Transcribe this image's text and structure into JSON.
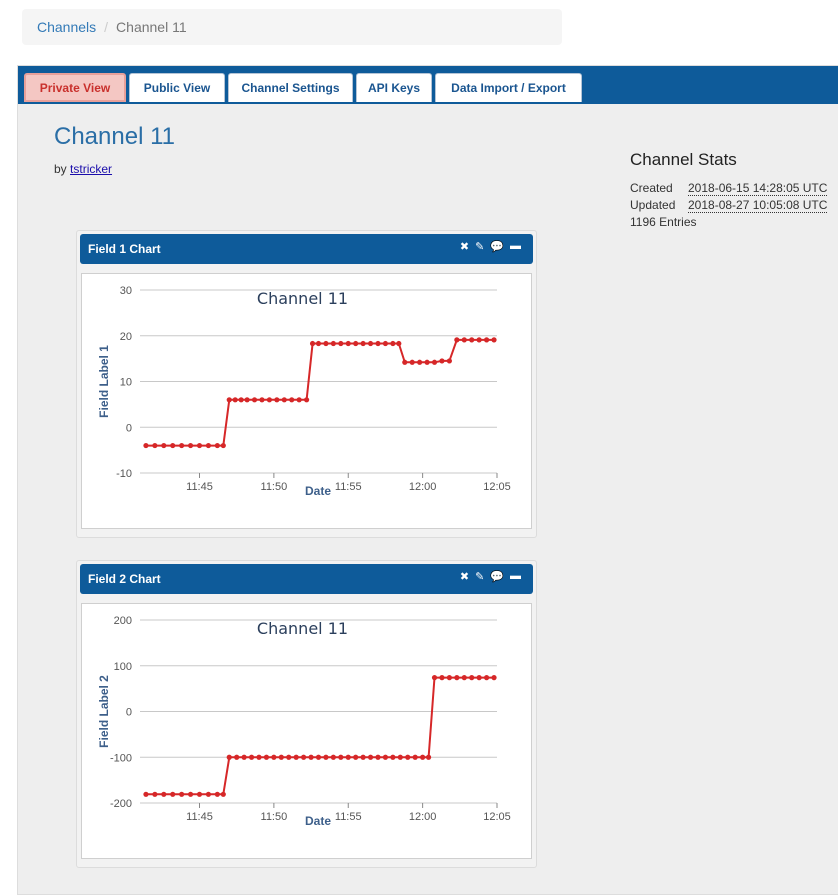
{
  "breadcrumb": {
    "root": "Channels",
    "separator": "/",
    "current": "Channel 11"
  },
  "tabs": [
    {
      "label": "Private View",
      "active": true
    },
    {
      "label": "Public View",
      "active": false
    },
    {
      "label": "Channel Settings",
      "active": false
    },
    {
      "label": "API Keys",
      "active": false
    },
    {
      "label": "Data Import / Export",
      "active": false
    }
  ],
  "channel": {
    "title": "Channel 11",
    "by_prefix": "by",
    "author": "tstricker"
  },
  "stats": {
    "heading": "Channel Stats",
    "created_label": "Created",
    "created_value": "2018-06-15 14:28:05 UTC",
    "updated_label": "Updated",
    "updated_value": "2018-08-27 10:05:08 UTC",
    "entries": "1196 Entries"
  },
  "panels": [
    {
      "title": "Field 1 Chart",
      "tools": {
        "close": "✖",
        "edit": "✎",
        "comment": "💬",
        "minimize": "▬"
      }
    },
    {
      "title": "Field 2 Chart",
      "tools": {
        "close": "✖",
        "edit": "✎",
        "comment": "💬",
        "minimize": "▬"
      }
    }
  ],
  "colors": {
    "tabbar": "#0e5b9a",
    "series": "#d62728",
    "accent": "#2a6ea6"
  },
  "chart_data": [
    {
      "type": "line",
      "title": "Channel 11",
      "xlabel": "Date",
      "ylabel": "Field Label 1",
      "xlim": [
        "11:41",
        "12:05"
      ],
      "ylim": [
        -10,
        30
      ],
      "yticks": [
        -10,
        0,
        10,
        20,
        30
      ],
      "xticks": [
        "11:45",
        "11:50",
        "11:55",
        "12:00",
        "12:05"
      ],
      "grid": true,
      "series": [
        {
          "x": [
            "11:41:24",
            "11:42:00",
            "11:42:36",
            "11:43:12",
            "11:43:48",
            "11:44:24",
            "11:45:00",
            "11:45:36",
            "11:46:12",
            "11:46:36",
            "11:47:00",
            "11:47:24",
            "11:47:48",
            "11:48:12",
            "11:48:42",
            "11:49:12",
            "11:49:42",
            "11:50:12",
            "11:50:42",
            "11:51:12",
            "11:51:42",
            "11:52:12",
            "11:52:36",
            "11:53:00",
            "11:53:30",
            "11:54:00",
            "11:54:30",
            "11:55:00",
            "11:55:30",
            "11:56:00",
            "11:56:30",
            "11:57:00",
            "11:57:30",
            "11:58:00",
            "11:58:24",
            "11:58:48",
            "11:59:18",
            "11:59:48",
            "12:00:18",
            "12:00:48",
            "12:01:18",
            "12:01:48",
            "12:02:18",
            "12:02:48",
            "12:03:18",
            "12:03:48",
            "12:04:18",
            "12:04:48"
          ],
          "y": [
            -4,
            -4,
            -4,
            -4,
            -4,
            -4,
            -4,
            -4,
            -4,
            -4,
            6,
            6,
            6,
            6,
            6,
            6,
            6,
            6,
            6,
            6,
            6,
            6,
            18.3,
            18.3,
            18.3,
            18.3,
            18.3,
            18.3,
            18.3,
            18.3,
            18.3,
            18.3,
            18.3,
            18.3,
            18.3,
            14.2,
            14.2,
            14.2,
            14.2,
            14.2,
            14.5,
            14.5,
            19.1,
            19.1,
            19.1,
            19.1,
            19.1,
            19.1
          ]
        }
      ]
    },
    {
      "type": "line",
      "title": "Channel 11",
      "xlabel": "Date",
      "ylabel": "Field Label 2",
      "xlim": [
        "11:41",
        "12:05"
      ],
      "ylim": [
        -200,
        200
      ],
      "yticks": [
        -200,
        -100,
        0,
        100,
        200
      ],
      "xticks": [
        "11:45",
        "11:50",
        "11:55",
        "12:00",
        "12:05"
      ],
      "grid": true,
      "series": [
        {
          "x": [
            "11:41:24",
            "11:42:00",
            "11:42:36",
            "11:43:12",
            "11:43:48",
            "11:44:24",
            "11:45:00",
            "11:45:36",
            "11:46:12",
            "11:46:36",
            "11:47:00",
            "11:47:30",
            "11:48:00",
            "11:48:30",
            "11:49:00",
            "11:49:30",
            "11:50:00",
            "11:50:30",
            "11:51:00",
            "11:51:30",
            "11:52:00",
            "11:52:30",
            "11:53:00",
            "11:53:30",
            "11:54:00",
            "11:54:30",
            "11:55:00",
            "11:55:30",
            "11:56:00",
            "11:56:30",
            "11:57:00",
            "11:57:30",
            "11:58:00",
            "11:58:30",
            "11:59:00",
            "11:59:30",
            "12:00:00",
            "12:00:24",
            "12:00:48",
            "12:01:18",
            "12:01:48",
            "12:02:18",
            "12:02:48",
            "12:03:18",
            "12:03:48",
            "12:04:18",
            "12:04:48"
          ],
          "y": [
            -181,
            -181,
            -181,
            -181,
            -181,
            -181,
            -181,
            -181,
            -181,
            -181,
            -100,
            -100,
            -100,
            -100,
            -100,
            -100,
            -100,
            -100,
            -100,
            -100,
            -100,
            -100,
            -100,
            -100,
            -100,
            -100,
            -100,
            -100,
            -100,
            -100,
            -100,
            -100,
            -100,
            -100,
            -100,
            -100,
            -100,
            -100,
            74,
            74,
            74,
            74,
            74,
            74,
            74,
            74,
            74
          ]
        }
      ]
    }
  ]
}
